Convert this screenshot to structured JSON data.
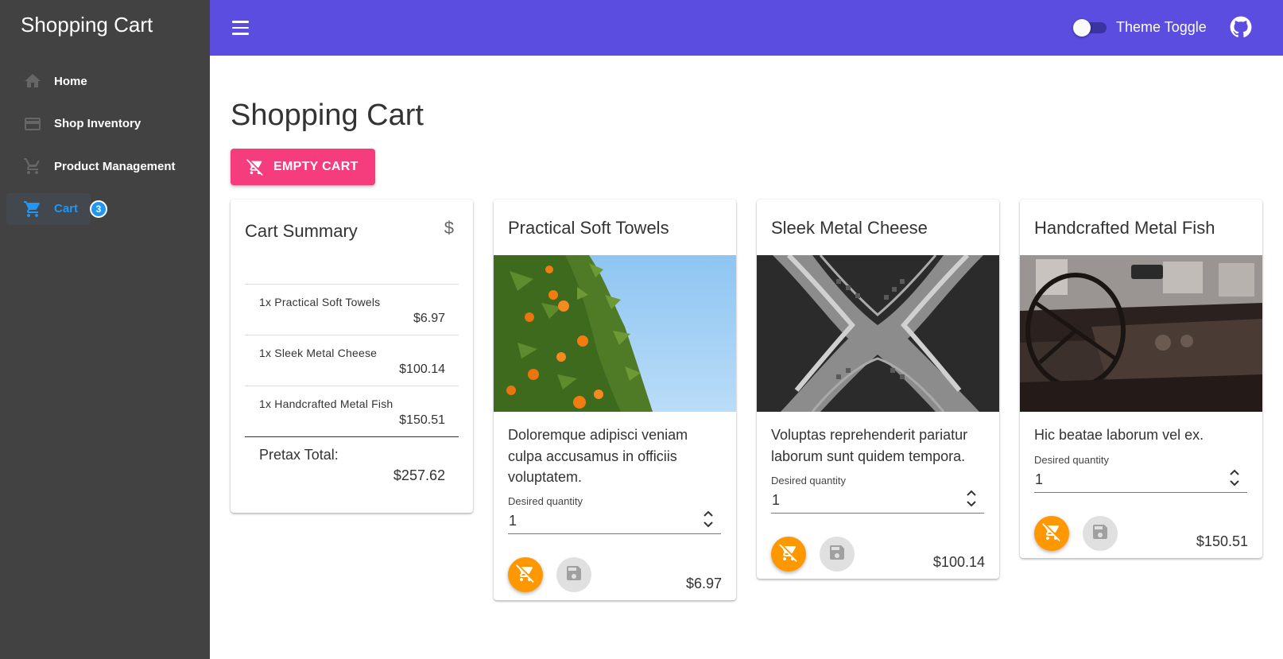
{
  "sidebar": {
    "title": "Shopping Cart",
    "items": [
      {
        "label": "Home",
        "icon": "home-icon"
      },
      {
        "label": "Shop Inventory",
        "icon": "credit-card-icon"
      },
      {
        "label": "Product Management",
        "icon": "cart-outline-icon"
      },
      {
        "label": "Cart",
        "icon": "cart-icon",
        "badge": "3",
        "active": true
      }
    ]
  },
  "appbar": {
    "toggle_label": "Theme Toggle",
    "menu_icon": "menu-icon",
    "github_icon": "github-icon",
    "color": "#5a4ddf"
  },
  "main": {
    "title": "Shopping Cart",
    "empty_cart_label": "EMPTY CART"
  },
  "summary": {
    "title": "Cart Summary",
    "currency_icon": "$",
    "items": [
      {
        "name": "1x Practical Soft Towels",
        "price": "$6.97"
      },
      {
        "name": "1x Sleek Metal Cheese",
        "price": "$100.14"
      },
      {
        "name": "1x Handcrafted Metal Fish",
        "price": "$150.51"
      }
    ],
    "total_label": "Pretax Total:",
    "total_value": "$257.62"
  },
  "products": [
    {
      "title": "Practical Soft Towels",
      "description": "Doloremque adipisci veniam culpa accusamus in officiis voluptatem.",
      "qty_label": "Desired quantity",
      "qty": "1",
      "price": "$6.97",
      "image": "orange-tree-image"
    },
    {
      "title": "Sleek Metal Cheese",
      "description": "Voluptas reprehenderit pariatur laborum sunt quidem tempora.",
      "qty_label": "Desired quantity",
      "qty": "1",
      "price": "$100.14",
      "image": "arch-ceiling-image"
    },
    {
      "title": "Handcrafted Metal Fish",
      "description": "Hic beatae laborum vel ex.",
      "qty_label": "Desired quantity",
      "qty": "1",
      "price": "$150.51",
      "image": "car-interior-image"
    }
  ],
  "colors": {
    "accent_pink": "#f53d7d",
    "accent_orange": "#ff9800",
    "active_blue": "#2196f3",
    "sidebar_bg": "#424242"
  }
}
